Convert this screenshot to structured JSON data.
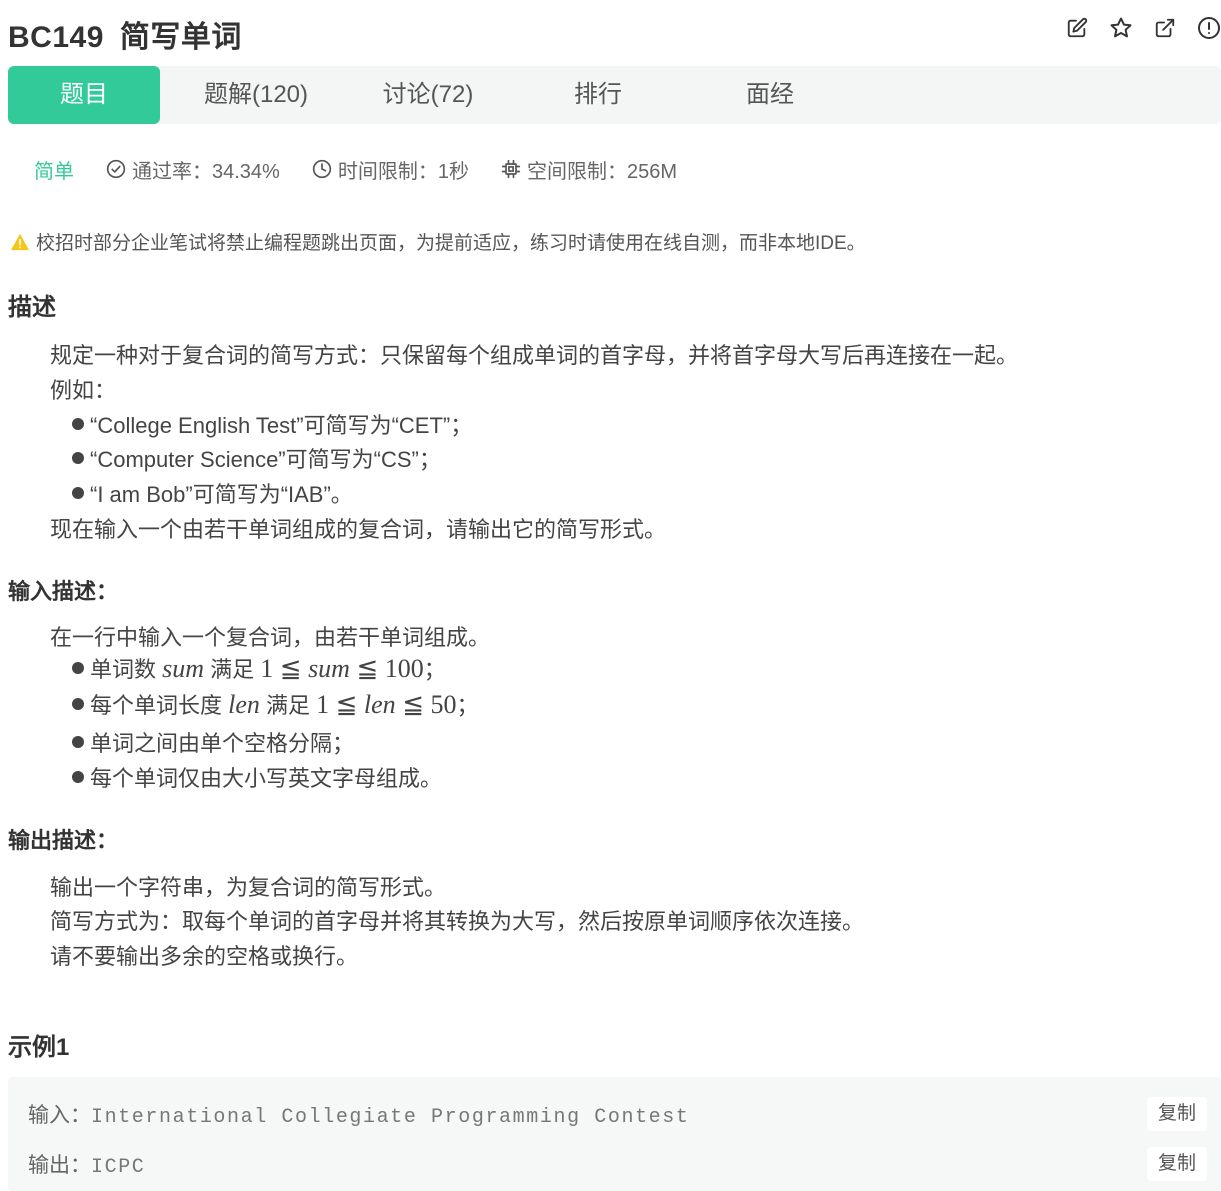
{
  "header": {
    "problem_id": "BC149",
    "problem_name": "简写单词",
    "actions": [
      "edit-icon",
      "star-icon",
      "external-link-icon",
      "alert-icon"
    ]
  },
  "tabs": [
    {
      "label": "题目",
      "active": true
    },
    {
      "label": "题解(120)",
      "active": false
    },
    {
      "label": "讨论(72)",
      "active": false
    },
    {
      "label": "排行",
      "active": false
    },
    {
      "label": "面经",
      "active": false
    }
  ],
  "meta": {
    "difficulty": "简单",
    "pass_rate": "通过率：34.34%",
    "time_limit": "时间限制：1秒",
    "memory_limit": "空间限制：256M"
  },
  "notice": "校招时部分企业笔试将禁止编程题跳出页面，为提前适应，练习时请使用在线自测，而非本地IDE。",
  "description": {
    "heading": "描述",
    "intro": "规定一种对于复合词的简写方式：只保留每个组成单词的首字母，并将首字母大写后再连接在一起。",
    "example_label": "例如：",
    "bullets": [
      "“College English Test”可简写为“CET”；",
      "“Computer Science”可简写为“CS”；",
      "“I am Bob”可简写为“IAB”。"
    ],
    "task": "现在输入一个由若干单词组成的复合词，请输出它的简写形式。"
  },
  "input_desc": {
    "heading": "输入描述：",
    "intro": "在一行中输入一个复合词，由若干单词组成。",
    "b1": {
      "pre": "单词数 ",
      "var": "sum",
      "mid": " 满足 ",
      "lo": "1",
      "op": "≦",
      "hi": "100",
      "end": "；"
    },
    "b2": {
      "pre": "每个单词长度 ",
      "var": "len",
      "mid": " 满足 ",
      "lo": "1",
      "op": "≦",
      "hi": "50",
      "end": "；"
    },
    "b3": "单词之间由单个空格分隔；",
    "b4": "每个单词仅由大小写英文字母组成。"
  },
  "output_desc": {
    "heading": "输出描述：",
    "lines": [
      "输出一个字符串，为复合词的简写形式。",
      "简写方式为：取每个单词的首字母并将其转换为大写，然后按原单词顺序依次连接。",
      "请不要输出多余的空格或换行。"
    ]
  },
  "example": {
    "heading": "示例1",
    "input_label": "输入：",
    "input_value": "International Collegiate Programming Contest",
    "output_label": "输出：",
    "output_value": "ICPC",
    "copy_label": "复制"
  },
  "colors": {
    "accent": "#32ca99",
    "warning": "#f5c518",
    "tab_bg": "#f4f5f5",
    "example_bg": "#f6f7f7"
  }
}
